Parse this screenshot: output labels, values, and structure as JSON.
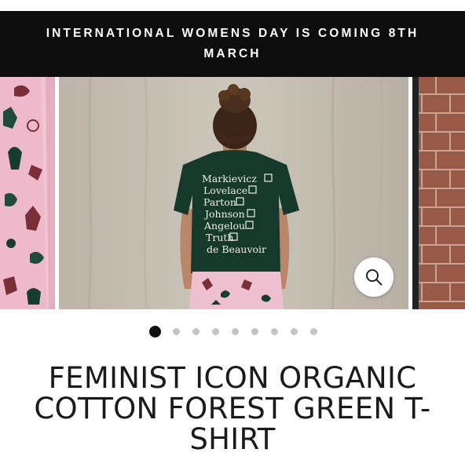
{
  "announcement": {
    "text": "INTERNATIONAL WOMENS DAY IS COMING 8TH MARCH"
  },
  "gallery": {
    "shirt_lines": [
      "Markievicz",
      "Lovelace",
      "Parton",
      "Johnson",
      "Angelou",
      "Truth",
      "de Beauvoir"
    ],
    "slide_count": 9,
    "active_index": 0,
    "zoom_icon": "magnifier-icon",
    "colors": {
      "shirt": "#153a2c",
      "backdrop": "#c6beb2",
      "pajama": "#eebfcf",
      "brick": "#9a5a48"
    }
  },
  "product": {
    "title": "FEMINIST ICON ORGANIC COTTON FOREST GREEN T-SHIRT"
  }
}
